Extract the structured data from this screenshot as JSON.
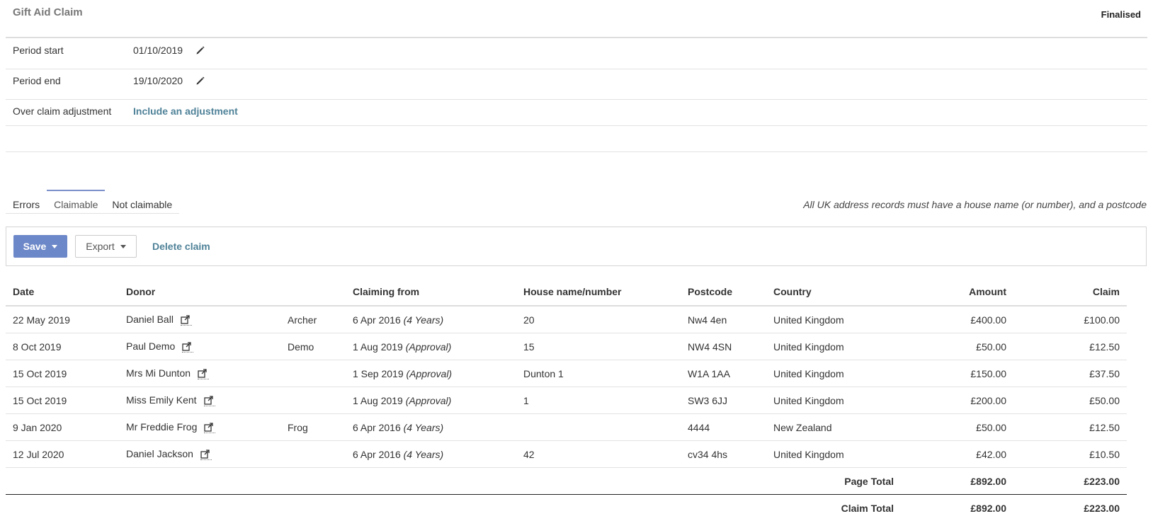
{
  "header": {
    "title": "Gift Aid Claim",
    "status": "Finalised"
  },
  "properties": [
    {
      "label": "Period start",
      "value": "01/10/2019"
    },
    {
      "label": "Period end",
      "value": "19/10/2020"
    },
    {
      "label": "Over claim adjustment",
      "link": "Include an adjustment"
    }
  ],
  "tabs": [
    "Errors",
    "Claimable",
    "Not claimable"
  ],
  "notice": "All UK address records must have a house name (or number), and a postcode",
  "toolbar": {
    "save": "Save",
    "export": "Export",
    "delete": "Delete claim"
  },
  "table": {
    "headers": [
      "Date",
      "Donor",
      "",
      "Claiming from",
      "House name/number",
      "Postcode",
      "Country",
      "Amount",
      "Claim"
    ],
    "rows": [
      {
        "date": "22 May 2019",
        "donor": "Daniel Ball",
        "extra": "Archer",
        "from": "6 Apr 2016",
        "from_note": "(4 Years)",
        "house": "20",
        "postcode": "Nw4 4en",
        "country": "United Kingdom",
        "amount": "£400.00",
        "claim": "£100.00"
      },
      {
        "date": "8 Oct 2019",
        "donor": "Paul Demo",
        "extra": "Demo",
        "from": "1 Aug 2019",
        "from_note": "(Approval)",
        "house": "15",
        "postcode": "NW4 4SN",
        "country": "United Kingdom",
        "amount": "£50.00",
        "claim": "£12.50"
      },
      {
        "date": "15 Oct 2019",
        "donor": "Mrs Mi Dunton",
        "extra": "",
        "from": "1 Sep 2019",
        "from_note": "(Approval)",
        "house": "Dunton 1",
        "postcode": "W1A 1AA",
        "country": "United Kingdom",
        "amount": "£150.00",
        "claim": "£37.50"
      },
      {
        "date": "15 Oct 2019",
        "donor": "Miss Emily Kent",
        "extra": "",
        "from": "1 Aug 2019",
        "from_note": "(Approval)",
        "house": "1",
        "postcode": "SW3 6JJ",
        "country": "United Kingdom",
        "amount": "£200.00",
        "claim": "£50.00"
      },
      {
        "date": "9 Jan 2020",
        "donor": "Mr Freddie Frog",
        "extra": "Frog",
        "from": "6 Apr 2016",
        "from_note": "(4 Years)",
        "house": "",
        "postcode": "4444",
        "country": "New Zealand",
        "amount": "£50.00",
        "claim": "£12.50"
      },
      {
        "date": "12 Jul 2020",
        "donor": "Daniel Jackson",
        "extra": "",
        "from": "6 Apr 2016",
        "from_note": "(4 Years)",
        "house": "42",
        "postcode": "cv34 4hs",
        "country": "United Kingdom",
        "amount": "£42.00",
        "claim": "£10.50"
      }
    ],
    "page_total": {
      "label": "Page Total",
      "amount": "£892.00",
      "claim": "£223.00"
    },
    "claim_total": {
      "label": "Claim Total",
      "amount": "£892.00",
      "claim": "£223.00"
    }
  },
  "colors": {
    "accent": "#6d88c8",
    "link": "#4f8298"
  },
  "icons": {
    "edit": "pencil-icon",
    "open": "external-link-icon",
    "dropdown": "caret-down-icon"
  }
}
